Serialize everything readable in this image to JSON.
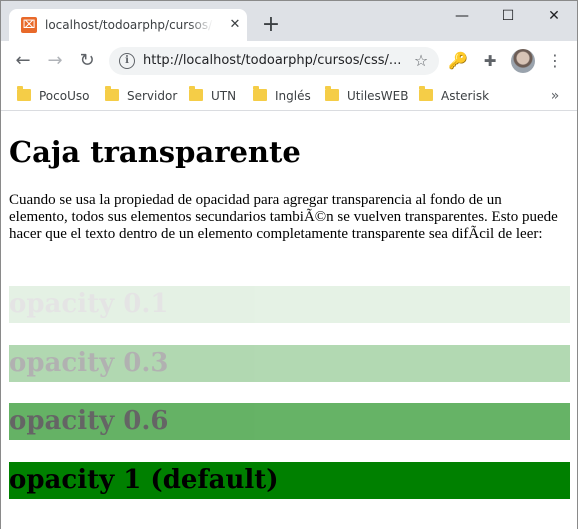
{
  "browser": {
    "tab": {
      "title": "localhost/todoarphp/cursos/css/opacidad",
      "favicon_letter": "⌧",
      "close_glyph": "✕"
    },
    "new_tab_glyph": "+",
    "window_controls": {
      "minimize": "—",
      "maximize": "☐",
      "close": "✕"
    },
    "nav": {
      "back": "←",
      "forward": "→",
      "reload": "↻"
    },
    "address": {
      "info_glyph": "i",
      "url": "http://localhost/todoarphp/cursos/css/...",
      "star_glyph": "☆"
    },
    "extensions": {
      "key_glyph": "🔑",
      "puzzle_glyph": "✚",
      "menu_glyph": "⋮"
    },
    "bookmarks": [
      "PocoUso",
      "Servidor",
      "UTN",
      "Inglés",
      "UtilesWEB",
      "Asterisk"
    ],
    "bookmarks_more": "»"
  },
  "page": {
    "title": "Caja transparente",
    "paragraph": "Cuando se usa la propiedad de opacidad para agregar transparencia al fondo de un elemento, todos sus elementos secundarios tambiÃ©n se vuelven transparentes. Esto puede hacer que el texto dentro de un elemento completamente transparente sea difÃcil de leer:",
    "boxes": [
      {
        "label": "opacity 0.1",
        "opacity": 0.1
      },
      {
        "label": "opacity 0.3",
        "opacity": 0.3
      },
      {
        "label": "opacity 0.6",
        "opacity": 0.6
      },
      {
        "label": "opacity 1 (default)",
        "opacity": 1
      }
    ],
    "box_color": "#008000"
  }
}
